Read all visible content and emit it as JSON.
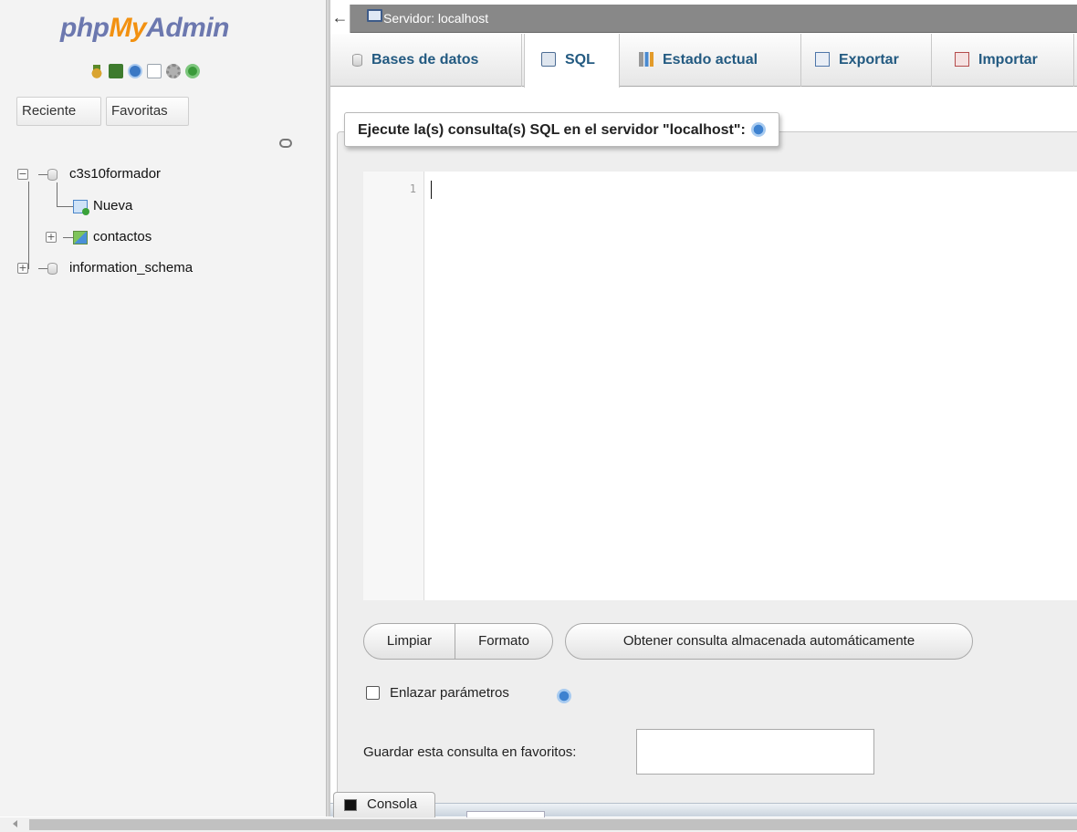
{
  "sidebar": {
    "logo": {
      "php": "php",
      "my": "My",
      "admin": "Admin"
    },
    "nav_icons": [
      "home-icon",
      "exit-icon",
      "help-icon",
      "documentation-icon",
      "settings-icon",
      "reload-icon"
    ],
    "tabs": {
      "recent": "Reciente",
      "favorites": "Favoritas"
    },
    "tree": [
      {
        "label": "c3s10formador",
        "expanded": true,
        "children": [
          {
            "label": "Nueva"
          },
          {
            "label": "contactos"
          }
        ]
      },
      {
        "label": "information_schema",
        "expanded": false
      }
    ]
  },
  "topbar": {
    "server_label": "Servidor: localhost",
    "collapse_glyph": "←"
  },
  "tabs": [
    {
      "label": "Bases de datos",
      "active": false
    },
    {
      "label": "SQL",
      "active": true
    },
    {
      "label": "Estado actual",
      "active": false
    },
    {
      "label": "Exportar",
      "active": false
    },
    {
      "label": "Importar",
      "active": false
    }
  ],
  "sql_panel": {
    "legend": "Ejecute la(s) consulta(s) SQL en el servidor \"localhost\":",
    "editor": {
      "line_number": "1",
      "content": ""
    },
    "buttons": {
      "clear": "Limpiar",
      "format": "Formato",
      "auto_query": "Obtener consulta almacenada automáticamente"
    },
    "bind_params": {
      "label": "Enlazar parámetros",
      "checked": false
    },
    "save_favorite": {
      "label": "Guardar esta consulta en favoritos:",
      "value": ""
    }
  },
  "console": {
    "label": "Consola"
  },
  "colors": {
    "logo_blue": "#6c78af",
    "logo_orange": "#f29111",
    "tab_text": "#235a81",
    "topbar": "#888888"
  }
}
